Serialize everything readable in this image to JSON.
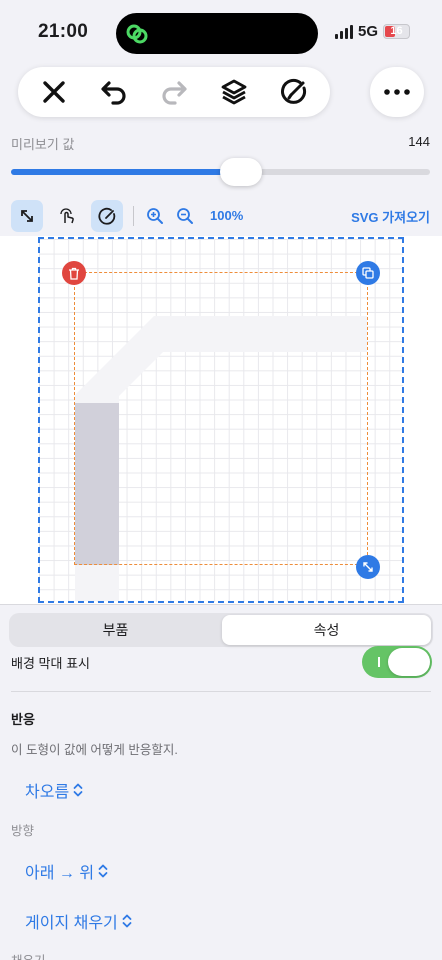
{
  "status_bar": {
    "time": "21:00",
    "network": "5G",
    "battery": "16"
  },
  "preview": {
    "label": "미리보기 값",
    "value": "144",
    "slider_fraction": 0.55
  },
  "canvas_toolbar": {
    "zoom": "100%",
    "import_svg": "SVG 가져오기"
  },
  "panel": {
    "tabs": [
      "부품",
      "속성"
    ],
    "active_tab": "속성",
    "background_bar_label": "배경 막대 표시",
    "background_bar_on": true,
    "reaction_title": "반응",
    "reaction_desc": "이 도형이 값에 어떻게 반응할지.",
    "reaction_value": "차오름",
    "direction_label": "방향",
    "direction_value": "아래 → 위",
    "fill_mode_value": "게이지 채우기",
    "fill_label": "채우기"
  },
  "colors": {
    "accent": "#2f7ae5",
    "delete": "#e0463f",
    "toggle_on": "#65c466",
    "selection_inner": "#ee8d3a",
    "fill": "#d1d0da"
  },
  "icons": [
    "close-icon",
    "undo-icon",
    "redo-icon",
    "layers-icon",
    "edit-gauge-icon",
    "more-icon",
    "resize-icon",
    "pointer-icon",
    "gauge-icon",
    "zoom-in-icon",
    "zoom-out-icon",
    "trash-icon",
    "duplicate-icon",
    "chevron-updown-icon"
  ]
}
